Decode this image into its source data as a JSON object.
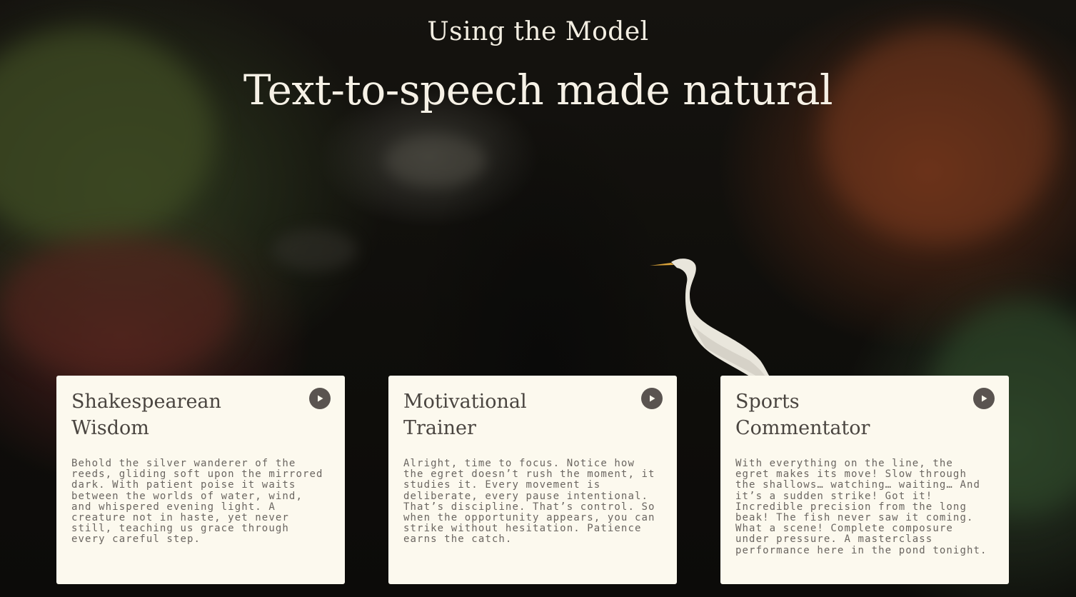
{
  "section": {
    "eyebrow": "Using the Model",
    "headline": "Text-to-speech made natural"
  },
  "cards": [
    {
      "title": "Shakespearean Wisdom",
      "play_icon": "play-icon",
      "text": "Behold the silver wanderer of the reeds, gliding soft upon the mirrored dark. With patient poise it waits between the worlds of water, wind, and whispered evening light. A creature not in haste, yet never still, teaching us grace through every careful step."
    },
    {
      "title": "Motivational Trainer",
      "play_icon": "play-icon",
      "text": "Alright, time to focus. Notice how the egret doesn’t rush the moment, it studies it. Every movement is deliberate, every pause intentional. That’s discipline. That’s control. So when the opportunity appears, you can strike without hesitation. Patience earns the catch."
    },
    {
      "title": "Sports Commentator",
      "play_icon": "play-icon",
      "text": "With everything on the line, the egret makes its move! Slow through the shallows… watching… waiting… And it’s a sudden strike! Got it! Incredible precision from the long beak! The fish never saw it coming. What a scene! Complete composure under pressure. A masterclass performance here in the pond tonight."
    }
  ],
  "colors": {
    "card_bg": "#fcf9ee",
    "title_text": "#4a4540",
    "body_text": "#6a6560",
    "play_button": "#5a5450",
    "heading_text": "#f6f1e6"
  }
}
